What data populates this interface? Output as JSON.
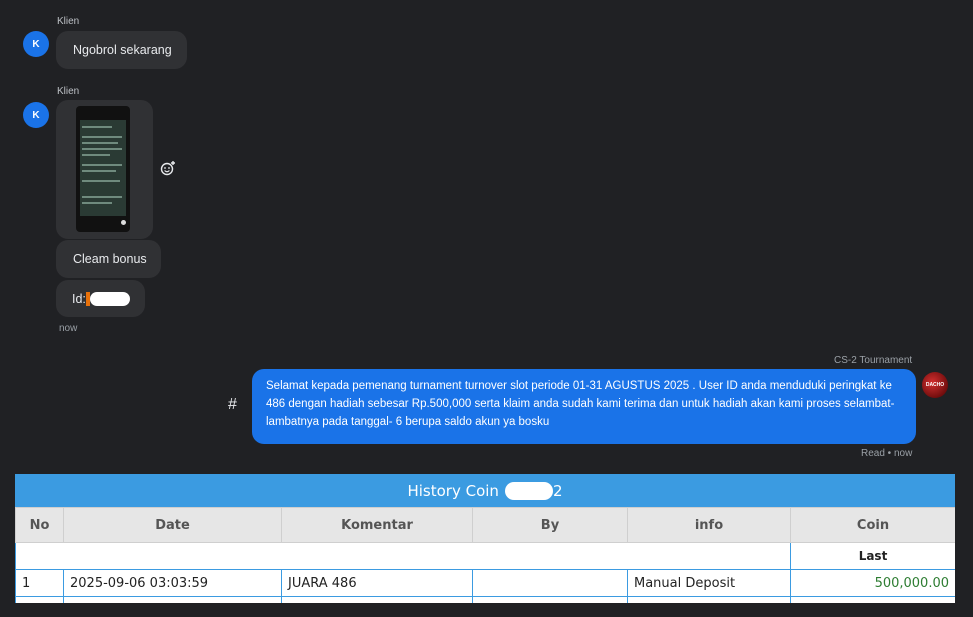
{
  "messages": {
    "m1": {
      "sender": "Klien",
      "avatar": "K",
      "text": "Ngobrol sekarang"
    },
    "m2": {
      "sender": "Klien",
      "avatar": "K",
      "text1": "Cleam bonus",
      "text2": "Id:",
      "time": "now"
    },
    "bot": {
      "sender": "CS-2 Tournament",
      "text": "Selamat kepada pemenang turnament turnover slot periode 01-31 AGUSTUS 2025 . User ID anda menduduki peringkat ke 486 dengan hadiah sebesar Rp.500,000 serta klaim anda sudah kami terima dan untuk hadiah akan kami proses selambat-lambatnya pada tanggal- 6 berupa saldo akun ya bosku",
      "status": "Read • now",
      "hash": "#",
      "avatar_text": "DACHO"
    }
  },
  "history": {
    "title_prefix": "History Coin",
    "title_suffix": "2",
    "headers": [
      "No",
      "Date",
      "Komentar",
      "By",
      "info",
      "Coin"
    ],
    "last_label": "Last",
    "rows": [
      {
        "no": "1",
        "date": "2025-09-06 03:03:59",
        "komentar": "JUARA 486",
        "by": "",
        "info": "Manual Deposit",
        "coin": "500,000.00"
      }
    ]
  },
  "icons": {
    "react": "add-reaction-icon"
  },
  "colors": {
    "accent": "#1a73e8",
    "table_header": "#3b9be1",
    "coin": "#2e7d32"
  }
}
